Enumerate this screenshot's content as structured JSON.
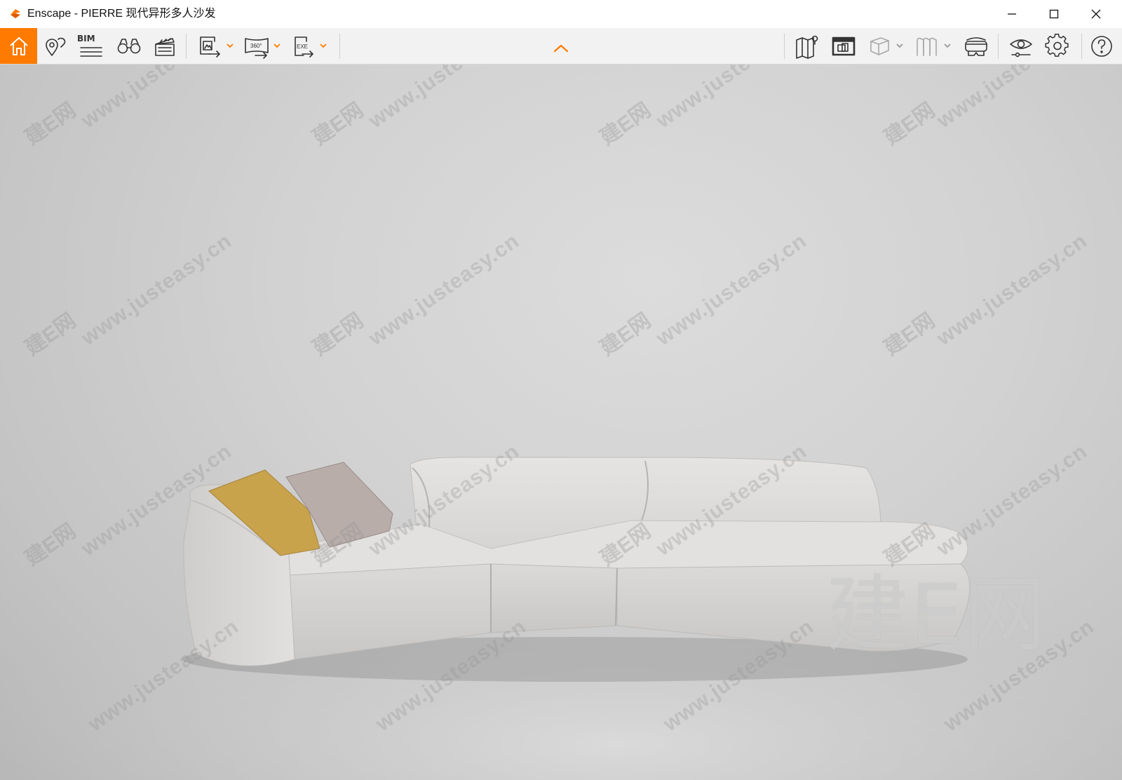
{
  "window": {
    "app_name": "Enscape",
    "title": "Enscape - PIERRE 现代异形多人沙发",
    "controls": [
      "minimize-icon",
      "maximize-icon",
      "close-icon"
    ]
  },
  "toolbar": {
    "accent_color": "#ff7a00",
    "left_tools": [
      {
        "name": "home-button",
        "icon": "home-icon",
        "active": true
      },
      {
        "name": "views-button",
        "icon": "map-pin-icon"
      },
      {
        "name": "bim-button",
        "icon": "bim-icon",
        "label": "BIM"
      },
      {
        "name": "walk-mode-button",
        "icon": "binoculars-icon"
      },
      {
        "name": "video-editor-button",
        "icon": "clapperboard-icon"
      },
      {
        "name": "screenshot-export-button",
        "icon": "image-export-icon",
        "has_dropdown": true
      },
      {
        "name": "panorama-export-button",
        "icon": "panorama-360-icon",
        "label": "360°",
        "has_dropdown": true
      },
      {
        "name": "exe-export-button",
        "icon": "exe-export-icon",
        "label": "EXE",
        "has_dropdown": true
      }
    ],
    "collapse_icon": "chevron-up-icon",
    "right_tools": [
      {
        "name": "map-button",
        "icon": "map-icon"
      },
      {
        "name": "asset-library-button",
        "icon": "asset-library-icon"
      },
      {
        "name": "section-box-button",
        "icon": "cube-icon",
        "disabled": true,
        "has_dropdown": true
      },
      {
        "name": "vr-view-button",
        "icon": "vr-book-icon",
        "disabled": true,
        "has_dropdown": true
      },
      {
        "name": "vr-headset-button",
        "icon": "vr-headset-icon"
      },
      {
        "name": "visual-settings-button",
        "icon": "eye-settings-icon"
      },
      {
        "name": "general-settings-button",
        "icon": "gear-icon"
      },
      {
        "name": "help-button",
        "icon": "help-icon"
      }
    ]
  },
  "viewport": {
    "watermark_url": "www.justeasy.cn",
    "watermark_cn": "建E网",
    "watermark_big": "建E网",
    "pillow_colors": [
      "#c9a24c",
      "#b7aba8"
    ]
  }
}
